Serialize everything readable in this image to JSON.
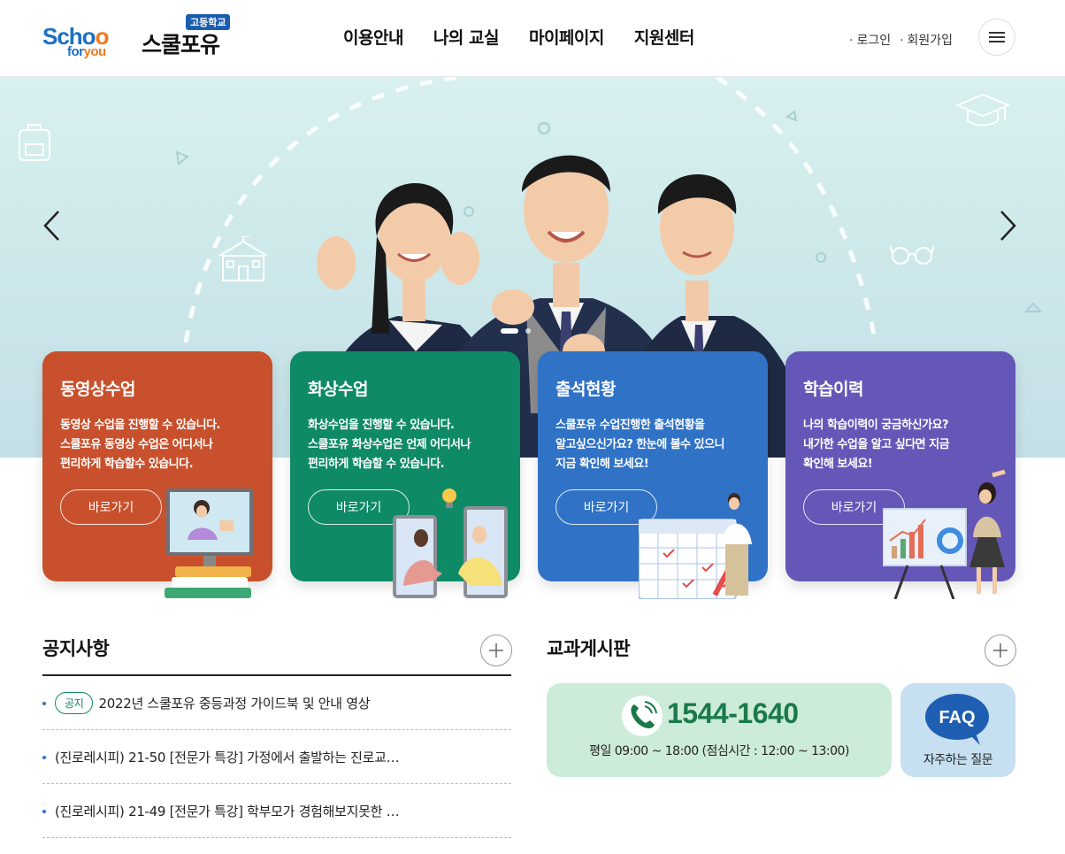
{
  "header": {
    "logo_school_1": "Scho",
    "logo_school_2": "o",
    "logo_for_1": "for",
    "logo_for_2": "you",
    "logo_badge": "고등학교",
    "logo_name": "스쿨포유",
    "nav": [
      "이용안내",
      "나의 교실",
      "마이페이지",
      "지원센터"
    ],
    "login": "로그인",
    "signup": "회원가입",
    "menu_icon": "hamburger-icon"
  },
  "hero": {
    "slide_count": 2,
    "active_slide": 1
  },
  "cards": [
    {
      "title": "동영상수업",
      "desc": [
        "동영상 수업을 진행할 수 있습니다.",
        "스쿨포유 동영상 수업은 어디서나",
        "편리하게 학습할수 있습니다."
      ],
      "button": "바로가기",
      "color": "#c8502c"
    },
    {
      "title": "화상수업",
      "desc": [
        "화상수업을 진행할 수 있습니다.",
        "스쿨포유 화상수업은 언제 어디서나",
        "편리하게 학습할 수 있습니다."
      ],
      "button": "바로가기",
      "color": "#0f8a67"
    },
    {
      "title": "출석현황",
      "desc": [
        "스쿨포유 수업진행한 출석현황을",
        "알고싶으신가요? 한눈에 볼수 있으니",
        "지금 확인해 보세요!"
      ],
      "button": "바로가기",
      "color": "#2f72c6"
    },
    {
      "title": "학습이력",
      "desc": [
        "나의 학습이력이 궁금하신가요?",
        "내가한 수업을 알고 싶다면 지금",
        "확인해 보세요!"
      ],
      "button": "바로가기",
      "color": "#6457b8"
    }
  ],
  "notice": {
    "title": "공지사항",
    "items": [
      {
        "tag": "공지",
        "text": "2022년 스쿨포유 중등과정 가이드북 및 안내 영상"
      },
      {
        "tag": "",
        "text": "(진로레시피) 21-50 [전문가 특강] 가정에서 출발하는 진로교…"
      },
      {
        "tag": "",
        "text": "(진로레시피) 21-49 [전문가 특강] 학부모가 경험해보지못한 …"
      }
    ]
  },
  "board": {
    "title": "교과게시판",
    "phone": "1544-1640",
    "hours": "평일 09:00 ~ 18:00 (점심시간 : 12:00 ~ 13:00)",
    "faq_label": "FAQ",
    "faq_text": "자주하는 질문"
  }
}
